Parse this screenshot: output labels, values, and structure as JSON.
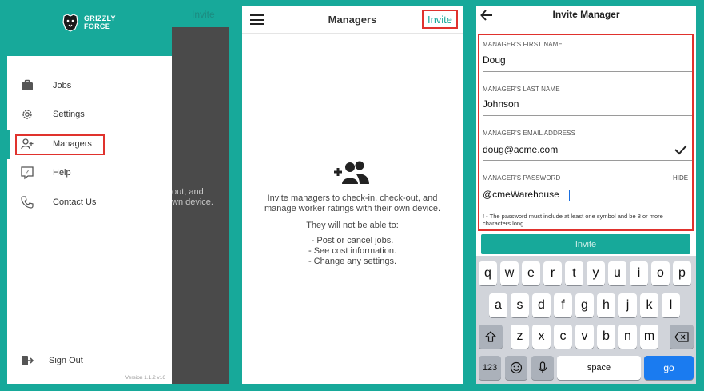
{
  "drawer": {
    "brand_line1": "GRIZZLY",
    "brand_line2": "FORCE",
    "background_invite": "Invite",
    "background_text_line1": "out, and",
    "background_text_line2": "wn device.",
    "items": [
      {
        "label": "Jobs",
        "icon": "briefcase-icon"
      },
      {
        "label": "Settings",
        "icon": "gear-icon"
      },
      {
        "label": "Managers",
        "icon": "person-add-icon"
      },
      {
        "label": "Help",
        "icon": "help-icon"
      },
      {
        "label": "Contact Us",
        "icon": "phone-icon"
      }
    ],
    "sign_out": "Sign Out",
    "version": "Version 1.1.2 v16"
  },
  "managers_screen": {
    "title": "Managers",
    "invite_label": "Invite",
    "desc_line1": "Invite managers to check-in, check-out, and",
    "desc_line2": "manage worker ratings with their own device.",
    "restriction_heading": "They will not be able to:",
    "restrictions": [
      "- Post or cancel jobs.",
      "- See cost information.",
      "- Change any settings."
    ]
  },
  "invite_screen": {
    "title": "Invite Manager",
    "fields": [
      {
        "label": "MANAGER'S FIRST NAME",
        "value": "Doug"
      },
      {
        "label": "MANAGER'S LAST NAME",
        "value": "Johnson"
      },
      {
        "label": "MANAGER'S EMAIL ADDRESS",
        "value": "doug@acme.com"
      },
      {
        "label": "MANAGER'S PASSWORD",
        "value": "@cmeWarehouse"
      }
    ],
    "hide_label": "HIDE",
    "password_hint": "! - The password must include at least one symbol and be 8 or more characters long.",
    "invite_button": "Invite",
    "keyboard": {
      "row1": [
        "q",
        "w",
        "e",
        "r",
        "t",
        "y",
        "u",
        "i",
        "o",
        "p"
      ],
      "row2": [
        "a",
        "s",
        "d",
        "f",
        "g",
        "h",
        "j",
        "k",
        "l"
      ],
      "row3": [
        "z",
        "x",
        "c",
        "v",
        "b",
        "n",
        "m"
      ],
      "numbers_key": "123",
      "space_key": "space",
      "go_key": "go"
    }
  },
  "colors": {
    "brand_teal": "#17a99a",
    "highlight_red": "#e0322d",
    "ios_blue": "#1a7bf0"
  }
}
